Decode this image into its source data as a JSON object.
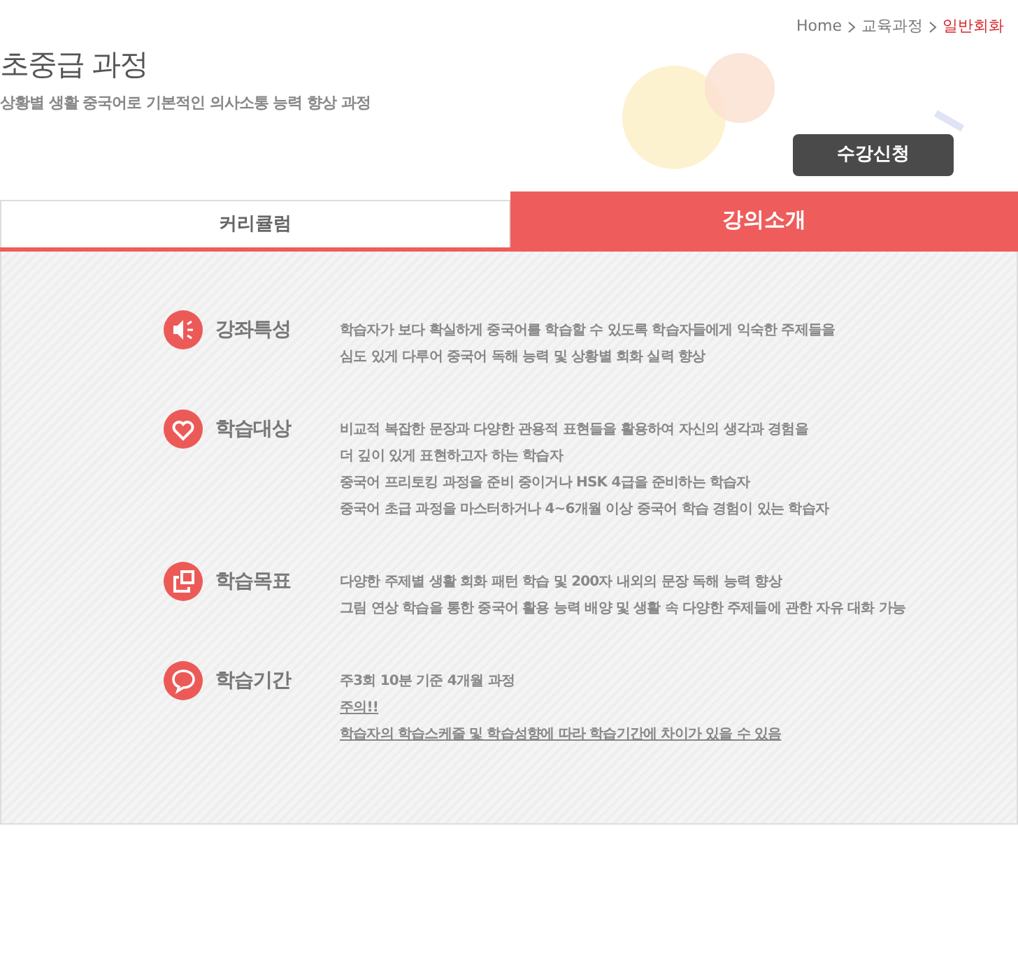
{
  "breadcrumb": [
    {
      "text": "Home",
      "selected": false
    },
    {
      "text": "교육과정",
      "selected": false
    },
    {
      "text": "일반회화",
      "selected": true
    }
  ],
  "title": "초중급 과정",
  "subtitle": "상황별 생활 중국어로 기본적인 의사소통 능력 향상 과정",
  "enroll_button": "수강신청",
  "tabs": [
    {
      "label": "커리큘럼",
      "selected": false
    },
    {
      "label": "강의소개",
      "selected": true
    }
  ],
  "sections": [
    {
      "kind": "speaker",
      "title": "강좌특성",
      "lines": [
        {
          "text": "학습자가 보다 확실하게 중국어를 학습할 수 있도록 학습자들에게 익숙한 주제들을",
          "underlined": false
        },
        {
          "text": "심도 있게 다루어 중국어 독해 능력 및 상황별 회화 실력 향상",
          "underlined": false
        }
      ]
    },
    {
      "kind": "heart",
      "title": "학습대상",
      "lines": [
        {
          "text": "비교적 복잡한 문장과 다양한 관용적 표현들을 활용하여 자신의 생각과 경험을",
          "underlined": false
        },
        {
          "text": "더 깊이 있게 표현하고자 하는 학습자",
          "underlined": false
        },
        {
          "text": "중국어 프리토킹 과정을 준비 중이거나 HSK 4급을 준비하는 학습자",
          "underlined": false
        },
        {
          "text": "중국어 초급 과정을 마스터하거나 4~6개월 이상 중국어 학습 경험이 있는 학습자",
          "underlined": false
        }
      ]
    },
    {
      "kind": "squares",
      "title": "학습목표",
      "lines": [
        {
          "text": "다양한 주제별 생활 회화 패턴 학습 및 200자 내외의 문장 독해 능력 향상",
          "underlined": false
        },
        {
          "text": "그림 연상 학습을 통한 중국어 활용 능력 배양 및 생활 속 다양한 주제들에 관한 자유 대화 가능",
          "underlined": false
        }
      ]
    },
    {
      "kind": "bubble",
      "title": "학습기간",
      "lines": [
        {
          "text": "주3회 10분 기준 4개월 과정",
          "underlined": false
        },
        {
          "text": "주의!!",
          "underlined": true
        },
        {
          "text": "학습자의 학습스케줄 및 학습성향에 따라 학습기간에 차이가 있을 수 있음",
          "underlined": true
        }
      ]
    }
  ]
}
